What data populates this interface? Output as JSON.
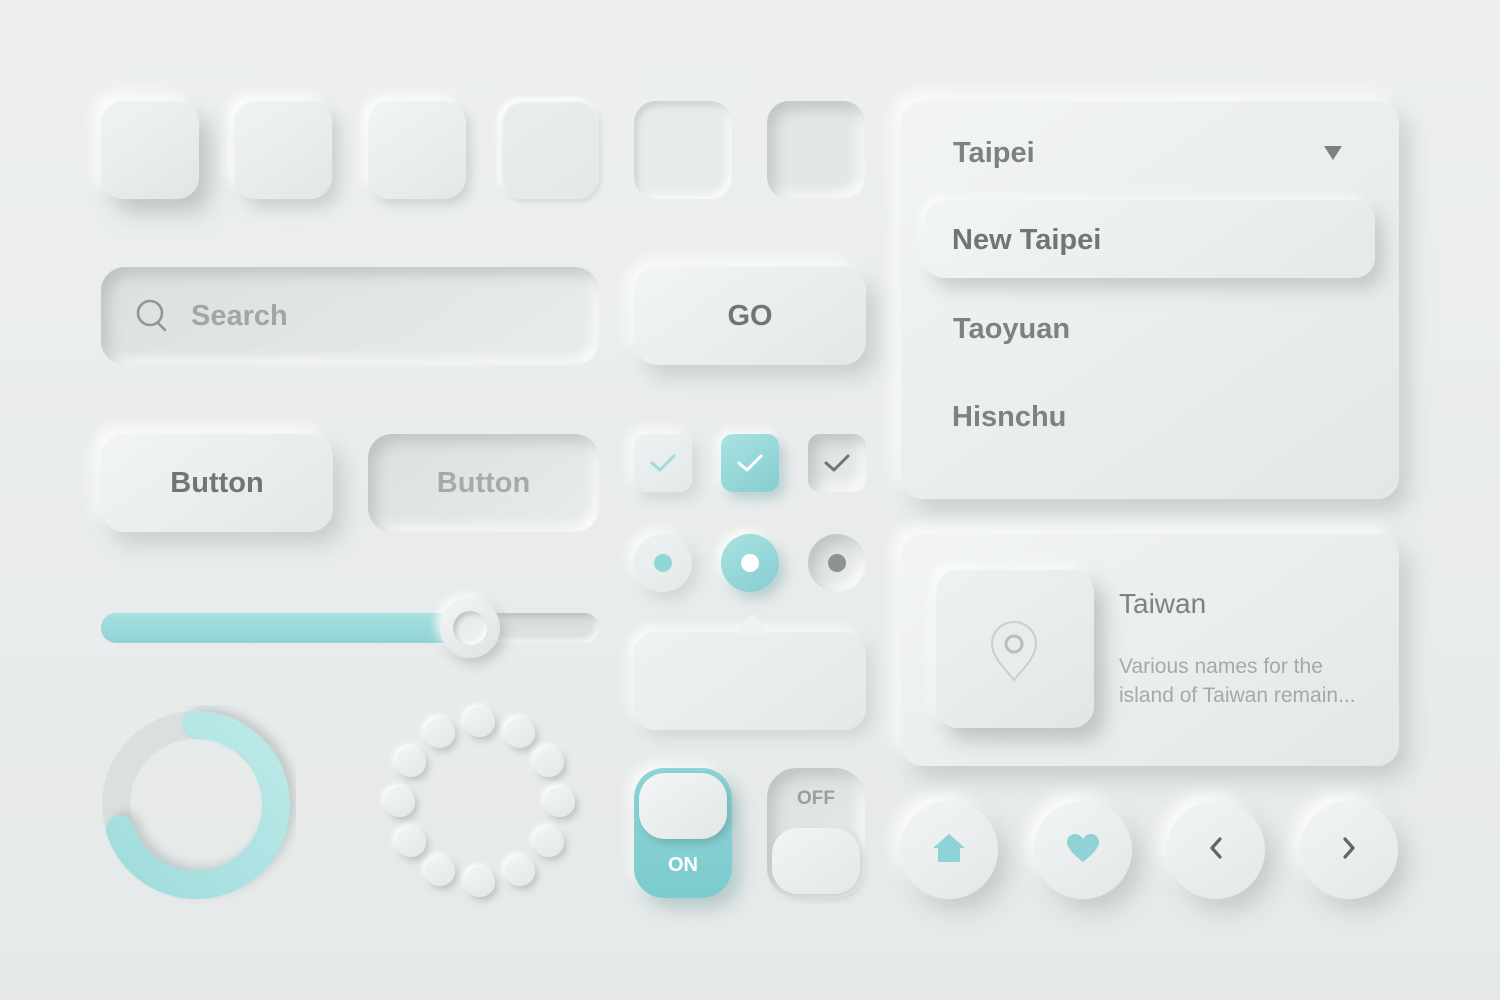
{
  "colors": {
    "background": "#eceeee",
    "accent": "#92d6d8",
    "text_strong": "#6f7676",
    "text_muted": "#a1a7a7"
  },
  "search": {
    "placeholder": "Search",
    "value": "",
    "icon": "search-icon"
  },
  "go_button": {
    "label": "GO"
  },
  "buttons": [
    {
      "label": "Button",
      "state": "raised"
    },
    {
      "label": "Button",
      "state": "pressed"
    }
  ],
  "checkboxes": [
    {
      "checked": true,
      "style": "light"
    },
    {
      "checked": true,
      "style": "accent"
    },
    {
      "checked": true,
      "style": "inset"
    }
  ],
  "radios": [
    {
      "selected": true,
      "style": "accent-dot"
    },
    {
      "selected": true,
      "style": "accent-fill"
    },
    {
      "selected": true,
      "style": "grey-dot"
    }
  ],
  "slider": {
    "value": 0.74
  },
  "progress_ring": {
    "value": 0.7
  },
  "toggles": [
    {
      "label": "ON",
      "on": true
    },
    {
      "label": "OFF",
      "on": false
    }
  ],
  "dropdown": {
    "selected": "Taipei",
    "caret_icon": "triangle-down-icon",
    "options": [
      "New Taipei",
      "Taoyuan",
      "Hisnchu"
    ],
    "highlighted_index": 0
  },
  "card": {
    "title": "Taiwan",
    "description_line1": "Various names for the",
    "description_line2": "island of Taiwan remain...",
    "icon": "map-pin-icon"
  },
  "nav_buttons": [
    {
      "icon": "home-icon"
    },
    {
      "icon": "heart-icon"
    },
    {
      "icon": "chevron-left-icon"
    },
    {
      "icon": "chevron-right-icon"
    }
  ]
}
